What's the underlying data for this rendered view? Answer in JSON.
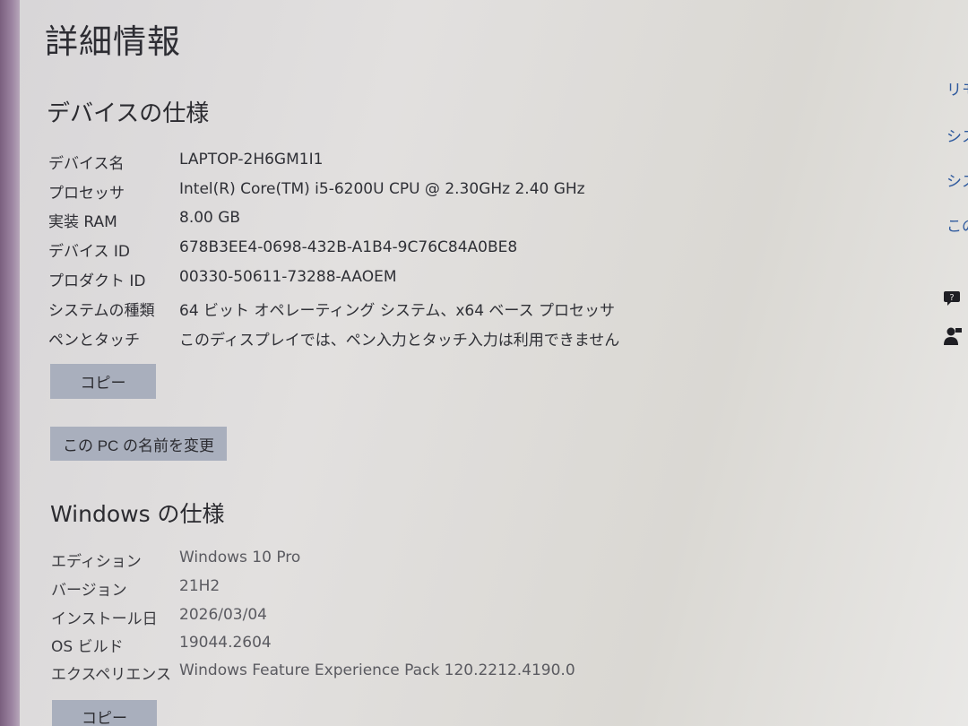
{
  "page_title": "詳細情報",
  "device_specs": {
    "heading": "デバイスの仕様",
    "rows": [
      {
        "label": "デバイス名",
        "value": "LAPTOP-2H6GM1I1"
      },
      {
        "label": "プロセッサ",
        "value": "Intel(R) Core(TM) i5-6200U CPU @ 2.30GHz   2.40 GHz"
      },
      {
        "label": "実装 RAM",
        "value": "8.00 GB"
      },
      {
        "label": "デバイス ID",
        "value": "678B3EE4-0698-432B-A1B4-9C76C84A0BE8"
      },
      {
        "label": "プロダクト ID",
        "value": "00330-50611-73288-AAOEM"
      },
      {
        "label": "システムの種類",
        "value": "64 ビット オペレーティング システム、x64 ベース プロセッサ"
      },
      {
        "label": "ペンとタッチ",
        "value": "このディスプレイでは、ペン入力とタッチ入力は利用できません"
      }
    ],
    "copy_label": "コピー",
    "rename_label": "この PC の名前を変更"
  },
  "windows_specs": {
    "heading": "Windows の仕様",
    "rows": [
      {
        "label": "エディション",
        "value": "Windows 10 Pro"
      },
      {
        "label": "バージョン",
        "value": "21H2"
      },
      {
        "label": "インストール日",
        "value": "2026/03/04"
      },
      {
        "label": "OS ビルド",
        "value": "19044.2604"
      },
      {
        "label": "エクスペリエンス",
        "value": "Windows Feature Experience Pack 120.2212.4190.0"
      }
    ],
    "copy_label": "コピー"
  },
  "related": {
    "links": [
      "リモー",
      "システ",
      "システ",
      "この PC"
    ],
    "help_icon": "help-chat-icon",
    "feedback_icon": "feedback-person-icon",
    "help_glyph": "ヘ",
    "feedback_glyph": "フ"
  }
}
